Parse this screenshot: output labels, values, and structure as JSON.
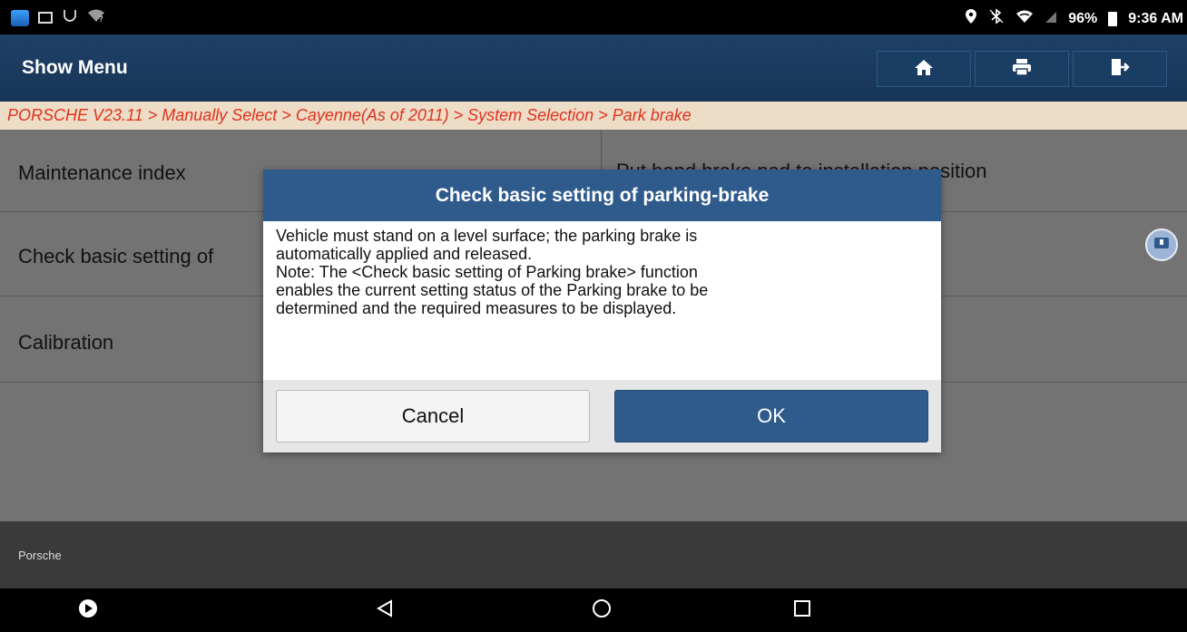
{
  "status_bar": {
    "battery": "96%",
    "time": "9:36 AM",
    "left_icons": [
      "app-icon",
      "gallery-icon",
      "usb-icon",
      "wifi-question-icon"
    ],
    "right_icons": [
      "location-icon",
      "bluetooth-icon",
      "wifi-icon",
      "no-sim-icon",
      "battery-icon"
    ]
  },
  "header": {
    "title": "Show Menu",
    "buttons": [
      "home-icon",
      "print-icon",
      "exit-icon"
    ]
  },
  "breadcrumb": "PORSCHE V23.11 > Manually Select > Cayenne(As of 2011) > System Selection > Park brake",
  "menu": {
    "items": [
      "Maintenance index",
      "Check basic setting of",
      "Calibration"
    ],
    "right_text": "Put hand brake pad to installation position"
  },
  "footer": {
    "brand": "Porsche"
  },
  "dialog": {
    "title": "Check basic setting of parking-brake",
    "body": "Vehicle must stand on a level surface; the parking brake is\nautomatically applied and released.\nNote: The <Check basic setting of Parking brake> function\nenables the current setting status of the Parking brake to be\ndetermined and the required measures to be displayed.",
    "cancel_label": "Cancel",
    "ok_label": "OK"
  },
  "colors": {
    "header": "#1f4068",
    "breadcrumb_text": "#e0331e",
    "dialog_accent": "#2f5a8c"
  },
  "nav_bar": [
    "play-icon",
    "back-icon",
    "home-circle-icon",
    "recents-icon"
  ]
}
